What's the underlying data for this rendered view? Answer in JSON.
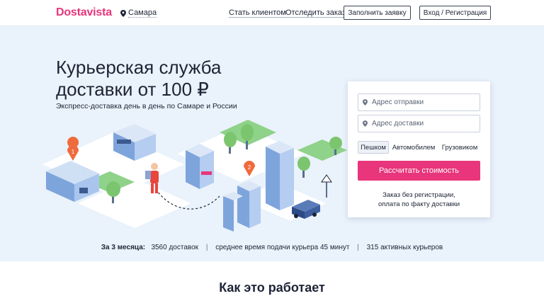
{
  "header": {
    "logo": "Dostavista",
    "city": "Самара",
    "links": {
      "become_client": "Стать клиентом",
      "track_order": "Отследить заказ"
    },
    "buttons": {
      "fill_request": "Заполнить заявку",
      "login_register": "Вход / Регистрация"
    }
  },
  "hero": {
    "title": "Курьерская служба доставки от 100 ₽",
    "subtitle": "Экспресс-доставка день в день по Самаре и России",
    "markers": [
      "1",
      "2"
    ]
  },
  "form": {
    "from_placeholder": "Адрес отправки",
    "to_placeholder": "Адрес доставки",
    "tabs": [
      "Пешком",
      "Автомобилем",
      "Грузовиком"
    ],
    "active_tab": "Пешком",
    "submit": "Рассчитать стоимость",
    "note_line1": "Заказ без регистрации,",
    "note_line2": "оплата по факту доставки"
  },
  "stats": {
    "period": "За 3 месяца:",
    "deliveries": "3560 доставок",
    "avg_time": "среднее время подачи курьера 45 минут",
    "couriers": "315 активных курьеров"
  },
  "how_it_works": {
    "title": "Как это работает"
  },
  "colors": {
    "brand": "#e8357b",
    "hero_bg": "#eaf2fb",
    "text": "#1d2436",
    "marker": "#ef6a3c"
  },
  "icons": {
    "location": "location-pin-icon"
  }
}
